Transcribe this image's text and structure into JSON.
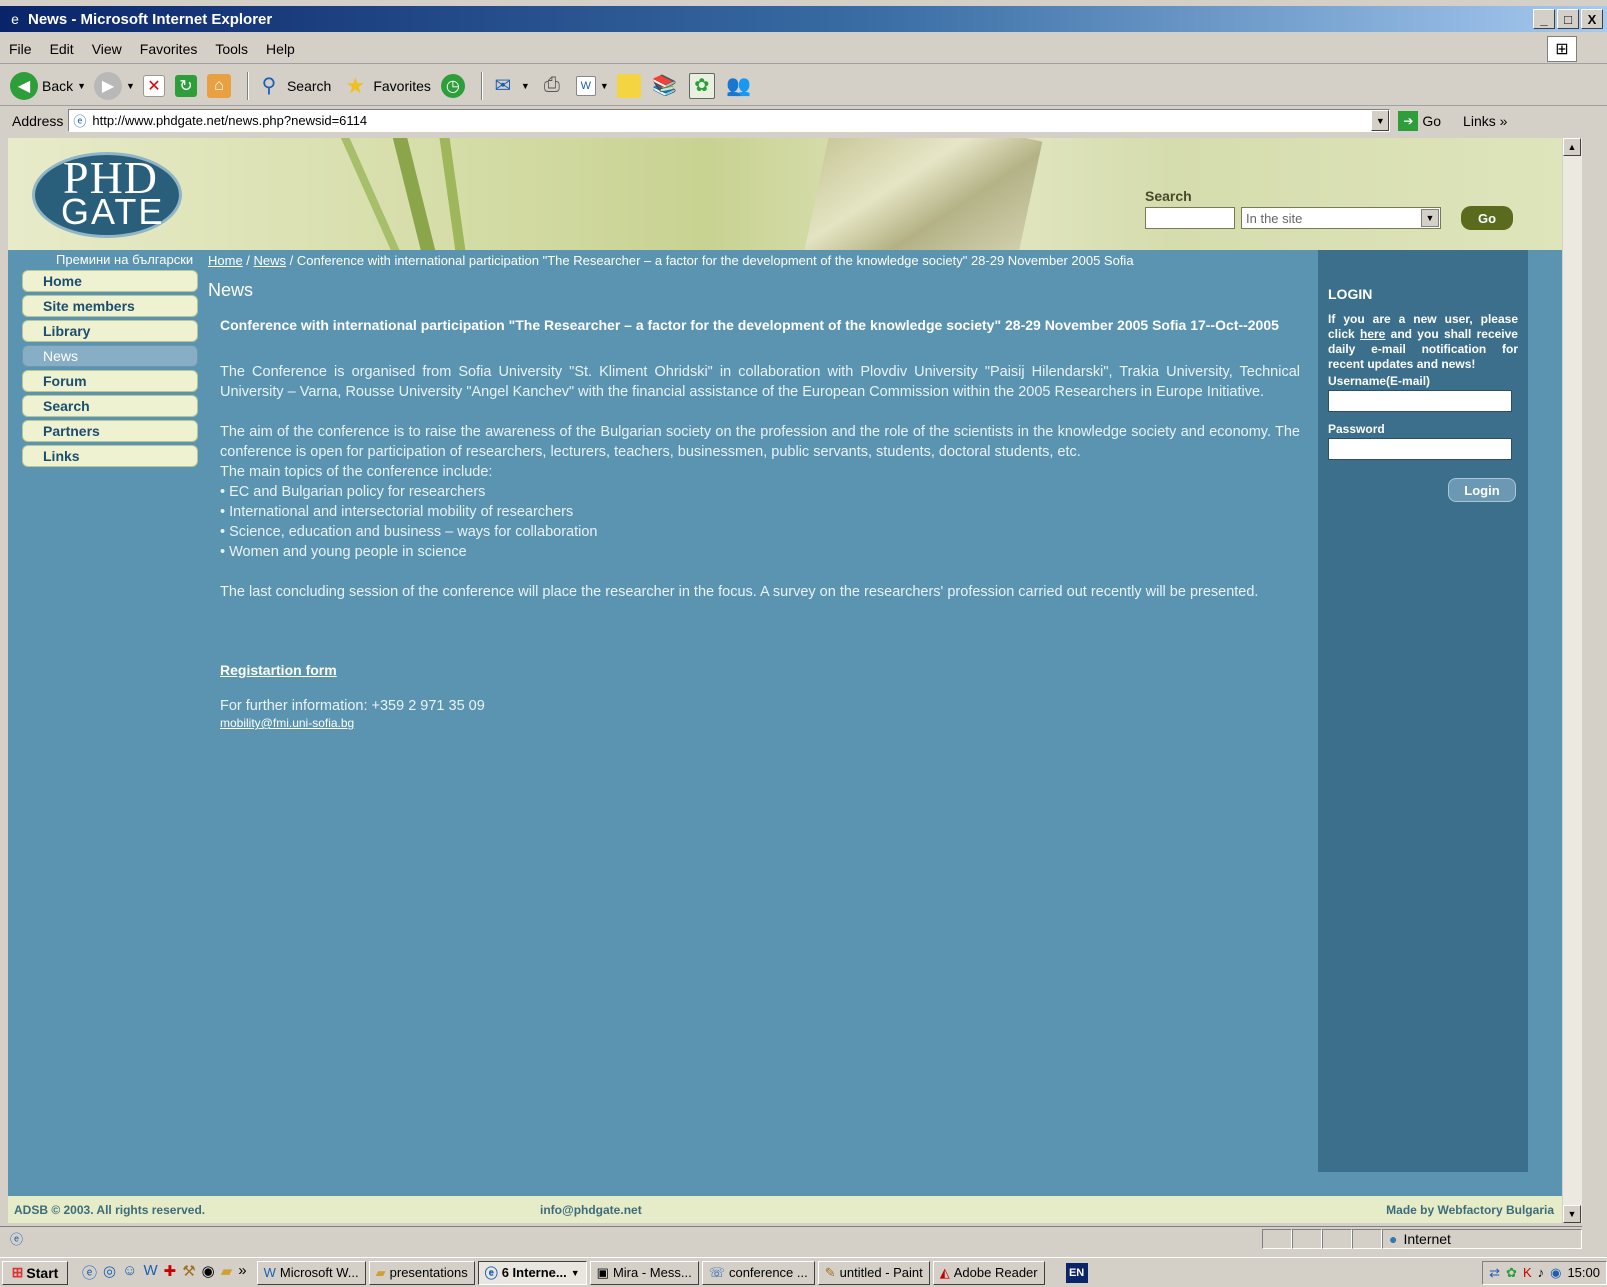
{
  "window": {
    "title": "News - Microsoft Internet Explorer",
    "btn_min": "_",
    "btn_max": "□",
    "btn_close": "X"
  },
  "menu": [
    "File",
    "Edit",
    "View",
    "Favorites",
    "Tools",
    "Help"
  ],
  "toolbar": {
    "back_label": "Back",
    "search_label": "Search",
    "favorites_label": "Favorites"
  },
  "address": {
    "label": "Address",
    "url": "http://www.phdgate.net/news.php?newsid=6114",
    "go_label": "Go",
    "links_label": "Links"
  },
  "site": {
    "logo_top": "PHD",
    "logo_bottom": "GATE",
    "search_label": "Search",
    "search_scope": "In the site",
    "search_go": "Go",
    "lang_link": "Премини на български"
  },
  "nav": [
    {
      "label": "Home",
      "active": false
    },
    {
      "label": "Site members",
      "active": false
    },
    {
      "label": "Library",
      "active": false
    },
    {
      "label": "News",
      "active": true
    },
    {
      "label": "Forum",
      "active": false
    },
    {
      "label": "Search",
      "active": false
    },
    {
      "label": "Partners",
      "active": false
    },
    {
      "label": "Links",
      "active": false
    }
  ],
  "breadcrumb": {
    "home": "Home",
    "sep": " / ",
    "news": "News",
    "current": "Conference with international participation \"The Researcher – a factor for the development of the knowledge society\" 28-29 November 2005 Sofia"
  },
  "section_title": "News",
  "article": {
    "headline": "Conference with international participation \"The Researcher – a factor for the development of the knowledge society\" 28-29 November 2005 Sofia    17--Oct--2005",
    "p1": "The Conference is organised from Sofia University \"St. Kliment Ohridski\" in collaboration with Plovdiv University \"Paisij Hilendarski\", Trakia University, Technical University – Varna, Rousse University \"Angel Kanchev\" with the financial assistance of the European Commission within the 2005 Researchers in Europe Initiative.",
    "p2": "The aim of the conference is to raise the awareness of the Bulgarian society on the profession and the role of the scientists in the knowledge society and economy. The conference is open for participation of researchers, lecturers, teachers, businessmen, public servants, students, doctoral students, etc.",
    "topics_intro": "The main topics of the conference include:",
    "topics": [
      "• EC and Bulgarian policy for researchers",
      "• International and intersectorial mobility of researchers",
      "• Science, education and business – ways for collaboration",
      "• Women and young people in science"
    ],
    "p3": "The last concluding session of the conference will place the researcher in the focus. A survey on the researchers' profession carried out recently will be presented.",
    "reg_link": "Registartion form",
    "info": "For further information: +359 2 971 35 09",
    "email": "mobility@fmi.uni-sofia.bg"
  },
  "login": {
    "title": "LOGIN",
    "text_before": "If you are a new user, please click ",
    "here": "here",
    "text_after": " and you shall receive daily e-mail notification for recent updates and news!",
    "username_label": "Username(E-mail)",
    "password_label": "Password",
    "button": "Login"
  },
  "footer": {
    "copyright": "ADSB © 2003. All rights reserved.",
    "email": "info@phdgate.net",
    "credit": "Made by Webfactory Bulgaria"
  },
  "status": {
    "zone": "Internet"
  },
  "taskbar": {
    "start": "Start",
    "tasks": [
      {
        "label": "Microsoft W...",
        "active": false
      },
      {
        "label": "presentations",
        "active": false
      },
      {
        "label": "6 Interne...",
        "active": true
      },
      {
        "label": "Mira - Mess...",
        "active": false
      },
      {
        "label": "conference ...",
        "active": false
      },
      {
        "label": "untitled - Paint",
        "active": false
      },
      {
        "label": "Adobe Reader",
        "active": false
      }
    ],
    "lang": "EN",
    "clock": "15:00"
  }
}
